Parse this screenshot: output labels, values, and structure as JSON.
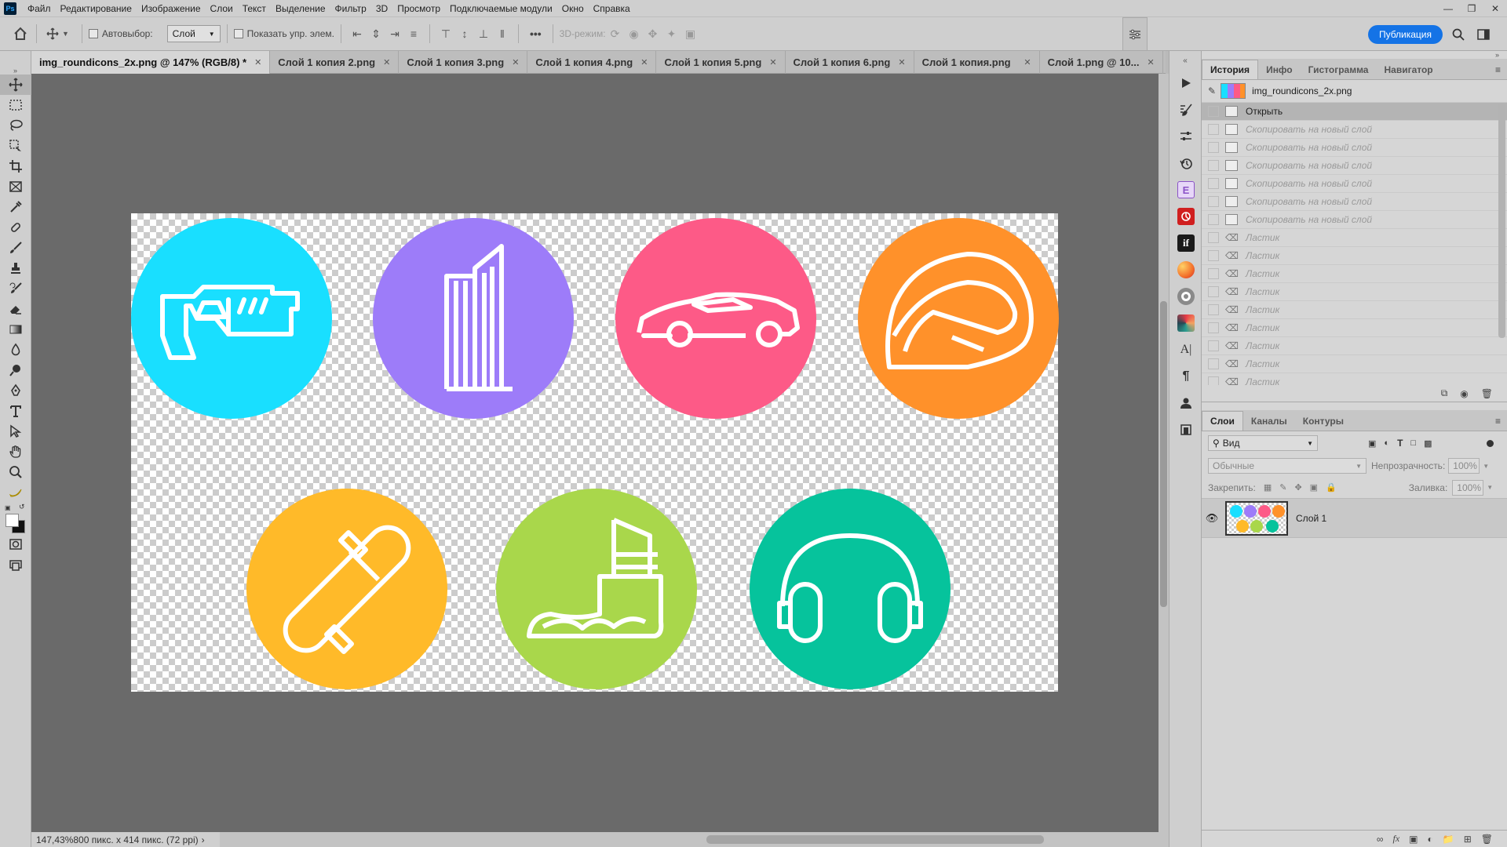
{
  "app": {
    "logo": "Ps"
  },
  "menu": [
    "Файл",
    "Редактирование",
    "Изображение",
    "Слои",
    "Текст",
    "Выделение",
    "Фильтр",
    "3D",
    "Просмотр",
    "Подключаемые модули",
    "Окно",
    "Справка"
  ],
  "options": {
    "autoselect_label": "Автовыбор:",
    "autoselect_value": "Слой",
    "show_controls_label": "Показать упр. элем.",
    "more": "•••",
    "mode3d_label": "3D-режим:",
    "publish_label": "Публикация"
  },
  "tabs": [
    {
      "label": "img_roundicons_2x.png @ 147% (RGB/8) *",
      "active": true
    },
    {
      "label": "Слой 1 копия 2.png",
      "active": false
    },
    {
      "label": "Слой 1 копия 3.png",
      "active": false
    },
    {
      "label": "Слой 1 копия 4.png",
      "active": false
    },
    {
      "label": "Слой 1 копия 5.png",
      "active": false
    },
    {
      "label": "Слой 1 копия 6.png",
      "active": false
    },
    {
      "label": "Слой 1 копия.png",
      "active": false
    },
    {
      "label": "Слой 1.png @ 10...",
      "active": false
    }
  ],
  "canvas": {
    "icons": [
      {
        "name": "blaster",
        "color": "#19dfff"
      },
      {
        "name": "building",
        "color": "#9d7cf9"
      },
      {
        "name": "car",
        "color": "#fd5a87"
      },
      {
        "name": "helmet",
        "color": "#ff912a"
      },
      {
        "name": "skateboard",
        "color": "#ffba29"
      },
      {
        "name": "sneaker",
        "color": "#a9d74b"
      },
      {
        "name": "headphones",
        "color": "#06c39c"
      }
    ]
  },
  "status": {
    "zoom": "147,43%",
    "doc_info": "800 пикс. x 414 пикс. (72 ppi)",
    "arrow": "›"
  },
  "history_panel": {
    "tabs": [
      "История",
      "Инфо",
      "Гистограмма",
      "Навигатор"
    ],
    "snapshot": "img_roundicons_2x.png",
    "steps": [
      {
        "label": "Открыть",
        "state": "selected"
      },
      {
        "label": "Скопировать на новый слой",
        "state": "disabled"
      },
      {
        "label": "Скопировать на новый слой",
        "state": "disabled"
      },
      {
        "label": "Скопировать на новый слой",
        "state": "disabled"
      },
      {
        "label": "Скопировать на новый слой",
        "state": "disabled"
      },
      {
        "label": "Скопировать на новый слой",
        "state": "disabled"
      },
      {
        "label": "Скопировать на новый слой",
        "state": "disabled"
      },
      {
        "label": "Ластик",
        "state": "disabled"
      },
      {
        "label": "Ластик",
        "state": "disabled"
      },
      {
        "label": "Ластик",
        "state": "disabled"
      },
      {
        "label": "Ластик",
        "state": "disabled"
      },
      {
        "label": "Ластик",
        "state": "disabled"
      },
      {
        "label": "Ластик",
        "state": "disabled"
      },
      {
        "label": "Ластик",
        "state": "disabled"
      },
      {
        "label": "Ластик",
        "state": "disabled"
      },
      {
        "label": "Ластик",
        "state": "disabled"
      }
    ]
  },
  "layers_panel": {
    "tabs": [
      "Слои",
      "Каналы",
      "Контуры"
    ],
    "filter_value": "Вид",
    "blend_mode": "Обычные",
    "opacity_label": "Непрозрачность:",
    "opacity_value": "100%",
    "lock_label": "Закрепить:",
    "fill_label": "Заливка:",
    "fill_value": "100%",
    "layers": [
      {
        "name": "Слой 1",
        "visible": true
      }
    ]
  },
  "footer_icons": [
    "link-icon",
    "fx",
    "mask-icon",
    "adjustment-icon",
    "folder-icon",
    "new-layer-icon",
    "trash-icon"
  ]
}
